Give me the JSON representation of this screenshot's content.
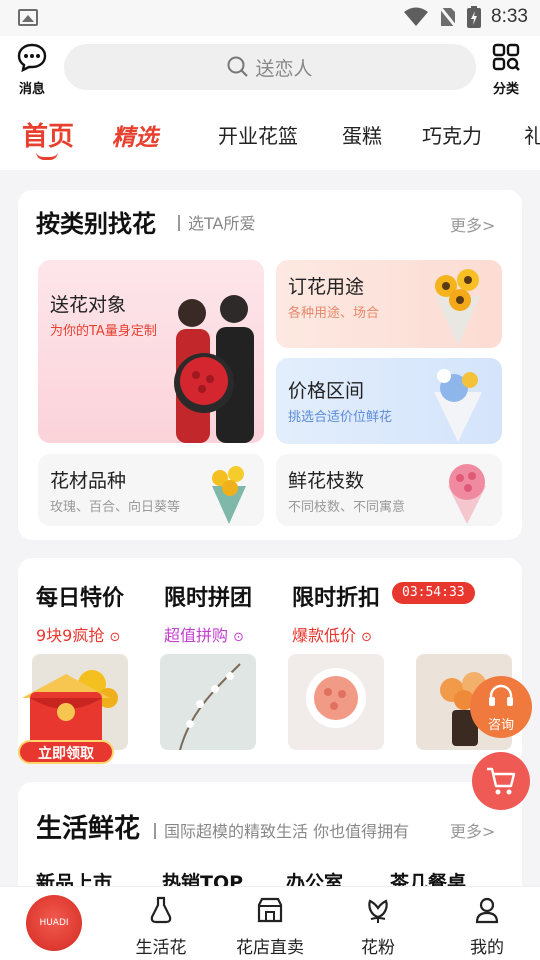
{
  "status": {
    "time": "8:33"
  },
  "header": {
    "msg_label": "消息",
    "search_placeholder": "送恋人",
    "category_label": "分类"
  },
  "tabs": [
    "首页",
    "精选",
    "开业花篮",
    "蛋糕",
    "巧克力",
    "礼"
  ],
  "section1": {
    "title": "按类别找花",
    "subtitle": "选TA所爱",
    "more": "更多>",
    "tiles": [
      {
        "title": "送花对象",
        "sub": "为你的TA量身定制"
      },
      {
        "title": "订花用途",
        "sub": "各种用途、场合"
      },
      {
        "title": "价格区间",
        "sub": "挑选合适价位鲜花"
      },
      {
        "title": "花材品种",
        "sub": "玫瑰、百合、向日葵等"
      },
      {
        "title": "鲜花枝数",
        "sub": "不同枝数、不同寓意"
      }
    ]
  },
  "deals": {
    "items": [
      {
        "title": "每日特价",
        "link": "9块9疯抢"
      },
      {
        "title": "限时拼团",
        "link": "超值拼购"
      },
      {
        "title": "限时折扣",
        "link": "爆款低价"
      }
    ],
    "timer": "03:54:33",
    "redpacket": "立即领取"
  },
  "section2": {
    "title": "生活鲜花",
    "subtitle": "国际超模的精致生活 你也值得拥有",
    "more": "更多>",
    "categories": [
      "新品上市",
      "热销TOP",
      "办公室",
      "茶几餐桌"
    ]
  },
  "float": {
    "consult": "咨询"
  },
  "bottom_nav": {
    "logo_text": "HUADI",
    "items": [
      "生活花",
      "花店直卖",
      "花粉",
      "我的"
    ]
  },
  "colors": {
    "accent": "#e8402f",
    "deal1": "#e8372f",
    "deal2": "#c23fd0",
    "deal3": "#e8372f"
  }
}
